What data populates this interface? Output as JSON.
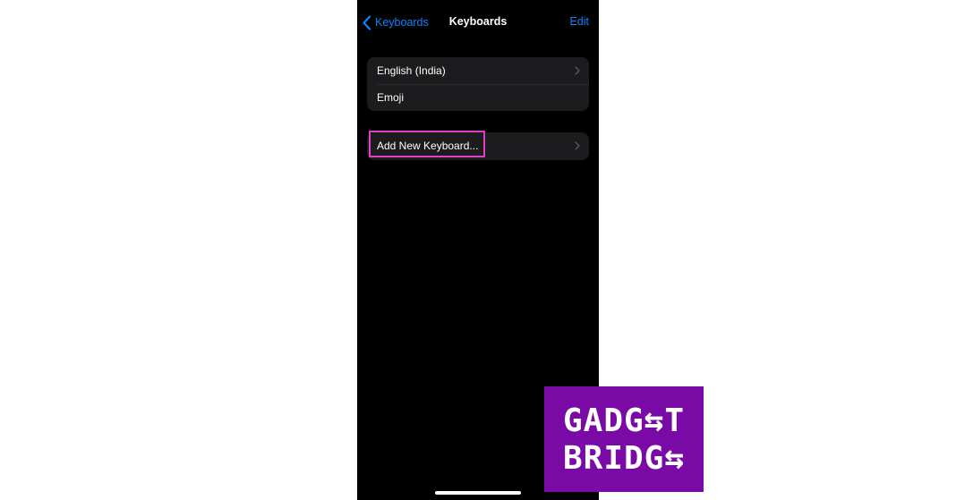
{
  "navbar": {
    "back_label": "Keyboards",
    "title": "Keyboards",
    "edit_label": "Edit"
  },
  "keyboards": [
    {
      "label": "English (India)",
      "has_chevron": true
    },
    {
      "label": "Emoji",
      "has_chevron": false
    }
  ],
  "add_keyboard": {
    "label": "Add New Keyboard..."
  },
  "colors": {
    "accent": "#0a84ff",
    "highlight": "#e040c8",
    "logo_bg": "#7a0aa6"
  },
  "logo": {
    "line1": "GADG⇆T",
    "line2": "BRIDG⇆"
  }
}
